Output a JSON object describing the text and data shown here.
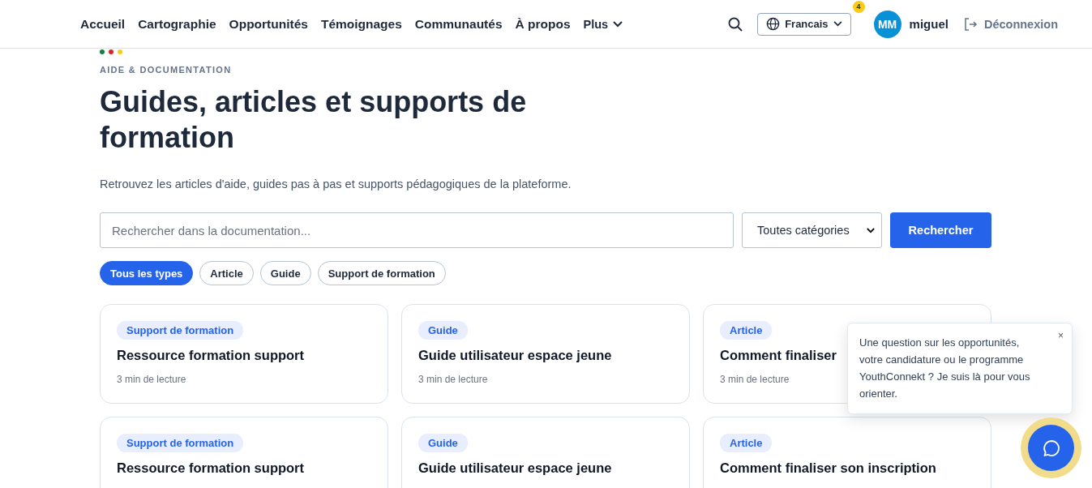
{
  "nav": {
    "items": [
      "Accueil",
      "Cartographie",
      "Opportunités",
      "Témoignages",
      "Communautés",
      "À propos"
    ],
    "more": "Plus",
    "language": "Francais",
    "notification_count": "4",
    "avatar_initials": "MM",
    "username": "miguel",
    "logout": "Déconnexion"
  },
  "header": {
    "eyebrow": "AIDE & DOCUMENTATION",
    "title": "Guides, articles et supports de formation",
    "subtitle": "Retrouvez les articles d'aide, guides pas à pas et supports pédagogiques de la plateforme."
  },
  "search": {
    "placeholder": "Rechercher dans la documentation...",
    "category": "Toutes catégories",
    "button": "Rechercher"
  },
  "filters": [
    {
      "label": "Tous les types",
      "selected": true
    },
    {
      "label": "Article",
      "selected": false
    },
    {
      "label": "Guide",
      "selected": false
    },
    {
      "label": "Support de formation",
      "selected": false
    }
  ],
  "cards": [
    {
      "tag": "Support de formation",
      "title": "Ressource formation support",
      "read_time": "3 min de lecture"
    },
    {
      "tag": "Guide",
      "title": "Guide utilisateur espace jeune",
      "read_time": "3 min de lecture"
    },
    {
      "tag": "Article",
      "title": "Comment finaliser",
      "read_time": "3 min de lecture"
    },
    {
      "tag": "Support de formation",
      "title": "Ressource formation support"
    },
    {
      "tag": "Guide",
      "title": "Guide utilisateur espace jeune"
    },
    {
      "tag": "Article",
      "title": "Comment finaliser son inscription"
    }
  ],
  "chat": {
    "message": "Une question sur les opportunités, votre candidature ou le programme YouthConnekt ? Je suis là pour vous orienter.",
    "close": "×"
  }
}
